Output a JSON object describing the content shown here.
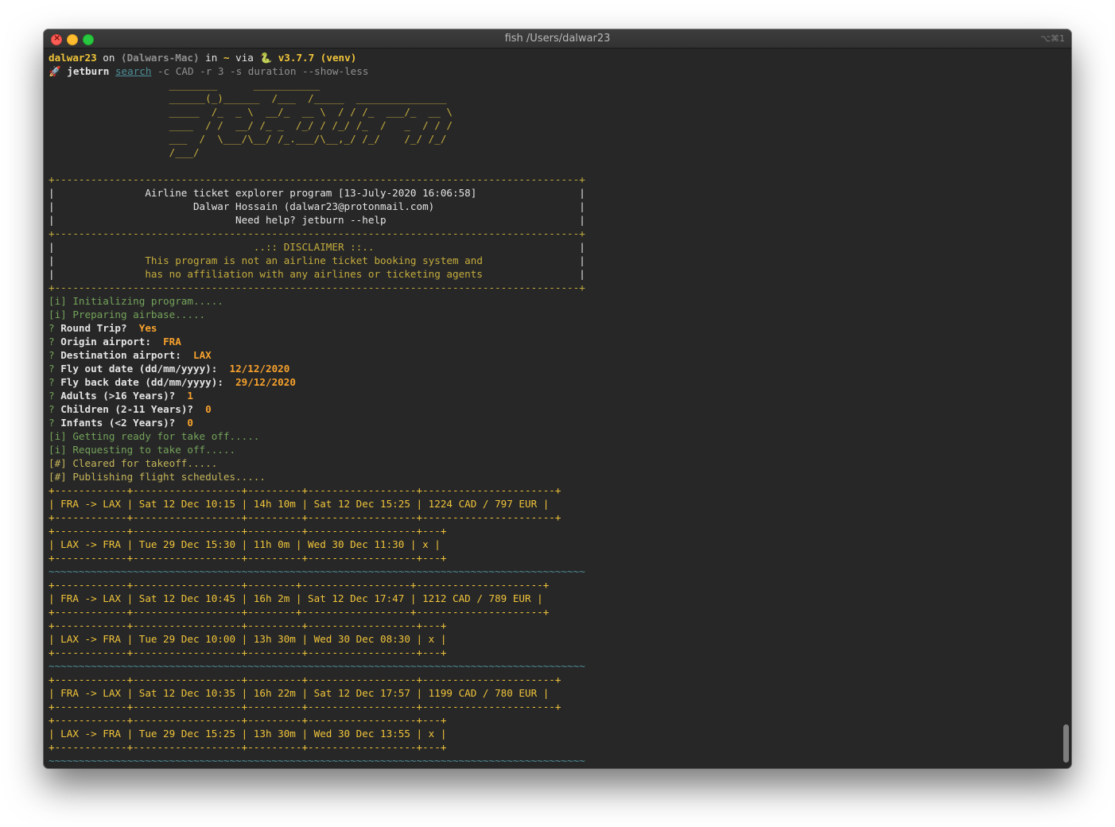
{
  "window": {
    "title": "fish /Users/dalwar23",
    "shortcut": "⌥⌘1"
  },
  "prompt": {
    "user": "dalwar23",
    "on": " on ",
    "host": "⟨Dalwars-Mac⟩",
    "in": " in ",
    "dir": "~",
    "via": " via ",
    "python_icon": "🐍",
    "python": " v3.7.7 (venv)",
    "rocket_icon": "🚀",
    "command": "jetburn",
    "subcommand": "search",
    "args": " -c CAD -r 3 -s duration --show-less"
  },
  "ascii_art": [
    "                    ________      ___________",
    "                    ______(_)______  /___  /_____  _______________",
    "                    _____  /_  _ \\  __/_  __ \\  / / /_  ___/_  __ \\",
    "                    ____  / /  __/ /_ _  /_/ / /_/ /_  /   _  / / /",
    "                    ___  /  \\___/\\__/ /_.___/\\__,_/ /_/    /_/ /_/",
    "                    /___/"
  ],
  "banner": {
    "border": "+---------------------------------------------------------------------------------------+",
    "lines": [
      "|               Airline ticket explorer program [13-July-2020 16:06:58]                 |",
      "|                       Dalwar Hossain (dalwar23@protonmail.com)                        |",
      "|                              Need help? jetburn --help                                |"
    ],
    "disclaimer_edge_left": "|",
    "disclaimer_edge_right": "|",
    "disclaimer_lines": [
      "                                 ..:: DISCLAIMER ::..                                  ",
      "               This program is not an airline ticket booking system and                ",
      "               has no affiliation with any airlines or ticketing agents                "
    ]
  },
  "log_init": [
    "[i] Initializing program.....",
    "[i] Preparing airbase....."
  ],
  "questions": [
    {
      "q": "Round Trip?",
      "a": "Yes"
    },
    {
      "q": "Origin airport:",
      "a": "FRA"
    },
    {
      "q": "Destination airport:",
      "a": "LAX"
    },
    {
      "q": "Fly out date (dd/mm/yyyy):",
      "a": "12/12/2020"
    },
    {
      "q": "Fly back date (dd/mm/yyyy):",
      "a": "29/12/2020"
    },
    {
      "q": "Adults (>16 Years)?",
      "a": "1"
    },
    {
      "q": "Children (2-11 Years)?",
      "a": "0"
    },
    {
      "q": "Infants (<2 Years)?",
      "a": "0"
    }
  ],
  "question_mark": "?",
  "log_ready": [
    "[i] Getting ready for take off.....",
    "[i] Requesting to take off....."
  ],
  "log_cleared": [
    "[#] Cleared for takeoff.....",
    "[#] Publishing flight schedules....."
  ],
  "results": [
    {
      "out": {
        "border": "+------------+------------------+---------+------------------+----------------------+",
        "row": "| FRA -> LAX | Sat 12 Dec 10:15 | 14h 10m | Sat 12 Dec 15:25 | 1224 CAD / 797 EUR |"
      },
      "back": {
        "border": "+------------+------------------+---------+------------------+---+",
        "row": "| LAX -> FRA | Tue 29 Dec 15:30 | 11h 0m | Wed 30 Dec 11:30 | x |"
      }
    },
    {
      "out": {
        "border": "+------------+------------------+--------+------------------+---------------------+",
        "row": "| FRA -> LAX | Sat 12 Dec 10:45 | 16h 2m | Sat 12 Dec 17:47 | 1212 CAD / 789 EUR |"
      },
      "back": {
        "border": "+------------+------------------+---------+------------------+---+",
        "row": "| LAX -> FRA | Tue 29 Dec 10:00 | 13h 30m | Wed 30 Dec 08:30 | x |"
      }
    },
    {
      "out": {
        "border": "+------------+------------------+---------+------------------+----------------------+",
        "row": "| FRA -> LAX | Sat 12 Dec 10:35 | 16h 22m | Sat 12 Dec 17:57 | 1199 CAD / 780 EUR |"
      },
      "back": {
        "border": "+------------+------------------+---------+------------------+---+",
        "row": "| LAX -> FRA | Tue 29 Dec 15:25 | 13h 30m | Wed 30 Dec 13:55 | x |"
      }
    }
  ],
  "separator": "~~~~~~~~~~~~~~~~~~~~~~~~~~~~~~~~~~~~~~~~~~~~~~~~~~~~~~~~~~~~~~~~~~~~~~~~~~~~~~~~~~~~~~~~~",
  "colors": {
    "background": "#272727",
    "username": "#f0c43a",
    "answer": "#f7a12c",
    "info_log": "#74a35a",
    "hash_log": "#c5b55a",
    "separator": "#4e8f99"
  }
}
